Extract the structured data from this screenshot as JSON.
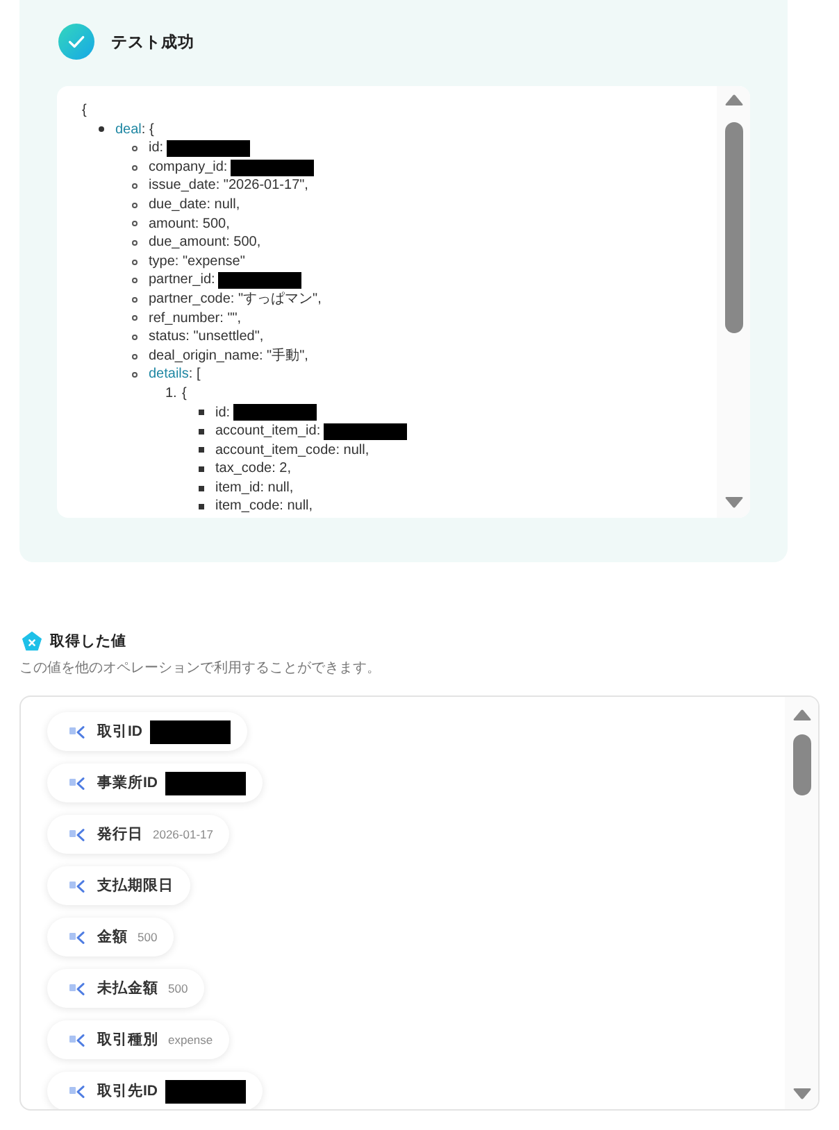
{
  "test_result": {
    "title": "テスト成功",
    "output": {
      "text": "{",
      "redacted": false,
      "children": [
        {
          "key": "deal",
          "text": ": {",
          "redacted": false,
          "children": [
            {
              "text": "id:",
              "redacted": true
            },
            {
              "text": "company_id:",
              "redacted": true
            },
            {
              "text": "issue_date: \"2026-01-17\",",
              "redacted": false
            },
            {
              "text": "due_date: null,",
              "redacted": false
            },
            {
              "text": "amount: 500,",
              "redacted": false
            },
            {
              "text": "due_amount: 500,",
              "redacted": false
            },
            {
              "text": "type: \"expense\"",
              "redacted": false
            },
            {
              "text": "partner_id:",
              "redacted": true
            },
            {
              "text": "partner_code: \"すっぱマン\",",
              "redacted": false
            },
            {
              "text": "ref_number: \"\",",
              "redacted": false
            },
            {
              "text": "status: \"unsettled\",",
              "redacted": false
            },
            {
              "text": "deal_origin_name: \"手動\",",
              "redacted": false
            },
            {
              "key": "details",
              "text": ": [",
              "redacted": false,
              "children": [
                {
                  "marker": "1.",
                  "text": "{",
                  "redacted": false,
                  "children": [
                    {
                      "text": "id:",
                      "redacted": true
                    },
                    {
                      "text": "account_item_id:",
                      "redacted": true
                    },
                    {
                      "text": "account_item_code: null,",
                      "redacted": false
                    },
                    {
                      "text": "tax_code: 2,",
                      "redacted": false
                    },
                    {
                      "text": "item_id: null,",
                      "redacted": false
                    },
                    {
                      "text": "item_code: null,",
                      "redacted": false
                    }
                  ]
                }
              ]
            }
          ]
        }
      ]
    }
  },
  "retrieved_values": {
    "title": "取得した値",
    "description": "この値を他のオペレーションで利用することができます。",
    "items": [
      {
        "label": "取引ID",
        "redacted": true
      },
      {
        "label": "事業所ID",
        "redacted": true
      },
      {
        "label": "発行日",
        "value": "2026-01-17",
        "redacted": false
      },
      {
        "label": "支払期限日",
        "redacted": false
      },
      {
        "label": "金額",
        "value": "500",
        "redacted": false
      },
      {
        "label": "未払金額",
        "value": "500",
        "redacted": false
      },
      {
        "label": "取引種別",
        "value": "expense",
        "redacted": false
      },
      {
        "label": "取引先ID",
        "redacted": true
      }
    ]
  }
}
